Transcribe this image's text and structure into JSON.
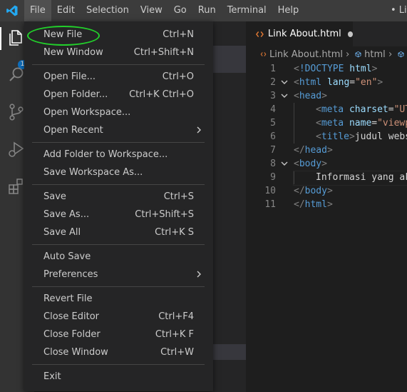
{
  "titlebar": {
    "menu": [
      "File",
      "Edit",
      "Selection",
      "View",
      "Go",
      "Run",
      "Terminal",
      "Help"
    ],
    "window_title": "• Li"
  },
  "activity_bar": {
    "badge": "1"
  },
  "tab": {
    "label": "Link About.html"
  },
  "breadcrumb": {
    "file": "Link About.html",
    "node": "html"
  },
  "editor": {
    "lines": [
      {
        "n": "1",
        "fold": "",
        "indent": 0,
        "code": "<!DOCTYPE html>"
      },
      {
        "n": "2",
        "fold": "v",
        "indent": 0,
        "code": "<html lang=\"en\">"
      },
      {
        "n": "3",
        "fold": "v",
        "indent": 0,
        "code": "<head>"
      },
      {
        "n": "4",
        "fold": "",
        "indent": 1,
        "code": "<meta charset=\"UT"
      },
      {
        "n": "5",
        "fold": "",
        "indent": 1,
        "code": "<meta name=\"viewp"
      },
      {
        "n": "6",
        "fold": "",
        "indent": 1,
        "code": "<title>judul webs"
      },
      {
        "n": "7",
        "fold": "",
        "indent": 0,
        "code": "</head>"
      },
      {
        "n": "8",
        "fold": "v",
        "indent": 0,
        "code": "<body>"
      },
      {
        "n": "9",
        "fold": "",
        "indent": 1,
        "code": "Informasi yang ak"
      },
      {
        "n": "10",
        "fold": "",
        "indent": 0,
        "code": "</body>"
      },
      {
        "n": "11",
        "fold": "",
        "indent": 0,
        "code": "</html>"
      }
    ]
  },
  "file_menu": {
    "groups": [
      [
        {
          "label": "New File",
          "shortcut": "Ctrl+N"
        },
        {
          "label": "New Window",
          "shortcut": "Ctrl+Shift+N"
        }
      ],
      [
        {
          "label": "Open File...",
          "shortcut": "Ctrl+O"
        },
        {
          "label": "Open Folder...",
          "shortcut": "Ctrl+K Ctrl+O"
        },
        {
          "label": "Open Workspace...",
          "shortcut": ""
        },
        {
          "label": "Open Recent",
          "shortcut": "",
          "submenu": true
        }
      ],
      [
        {
          "label": "Add Folder to Workspace...",
          "shortcut": ""
        },
        {
          "label": "Save Workspace As...",
          "shortcut": ""
        }
      ],
      [
        {
          "label": "Save",
          "shortcut": "Ctrl+S"
        },
        {
          "label": "Save As...",
          "shortcut": "Ctrl+Shift+S"
        },
        {
          "label": "Save All",
          "shortcut": "Ctrl+K S"
        }
      ],
      [
        {
          "label": "Auto Save",
          "shortcut": ""
        },
        {
          "label": "Preferences",
          "shortcut": "",
          "submenu": true
        }
      ],
      [
        {
          "label": "Revert File",
          "shortcut": ""
        },
        {
          "label": "Close Editor",
          "shortcut": "Ctrl+F4"
        },
        {
          "label": "Close Folder",
          "shortcut": "Ctrl+K F"
        },
        {
          "label": "Close Window",
          "shortcut": "Ctrl+W"
        }
      ],
      [
        {
          "label": "Exit",
          "shortcut": ""
        }
      ]
    ]
  },
  "colors": {
    "tag": "#569cd6",
    "attr": "#9cdcfe",
    "string": "#ce9178",
    "text": "#d4d4d4",
    "punct": "#808080",
    "highlight_ring": "#22d02b",
    "accent": "#0e70c0"
  },
  "icons": [
    "vscode-logo-icon",
    "files-icon",
    "search-icon",
    "source-control-icon",
    "run-debug-icon",
    "extensions-icon",
    "html-file-icon",
    "cube-icon",
    "chevron-right-icon"
  ]
}
